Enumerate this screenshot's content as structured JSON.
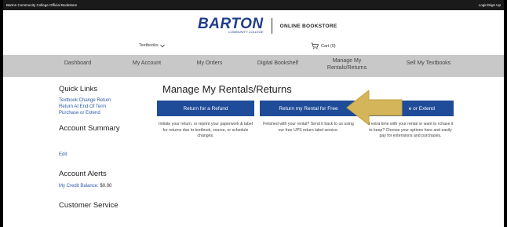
{
  "top_strip": {
    "site_label": "Barton Community College Official Bookstore",
    "login_label": "Login/Sign Up"
  },
  "brand": {
    "logo": "BARTON",
    "logo_sub": "COMMUNITY COLLEGE",
    "store_name": "ONLINE BOOKSTORE"
  },
  "subbar": {
    "textbooks_label": "Textbooks",
    "cart_label": "Cart (0)"
  },
  "nav": {
    "items": [
      {
        "label": "Dashboard"
      },
      {
        "label": "My Account"
      },
      {
        "label": "My Orders"
      },
      {
        "label": "Digital Bookshelf"
      },
      {
        "label": "Manage My\nRentals/Returns"
      },
      {
        "label": "Sell My Textbooks"
      }
    ]
  },
  "sidebar": {
    "quick_links_title": "Quick Links",
    "quick_links": [
      "Textbook Change Return",
      "Return At End Of Term",
      "Purchase or Extend"
    ],
    "account_summary_title": "Account Summary",
    "edit_label": "Edit",
    "account_alerts_title": "Account Alerts",
    "credit_balance_label": "My Credit Balance:",
    "credit_balance_value": "$0.00",
    "customer_service_title": "Customer Service"
  },
  "main": {
    "title": "Manage My Rentals/Returns",
    "actions": [
      {
        "label": "Return for a Refund",
        "description": "Initiate your return, or reprint your paperwork & label for returns due to textbook, course, or schedule changes."
      },
      {
        "label": "Return my Rental for Free",
        "description": "Finished with your rental? Send it back to us using our free UPS return label service."
      },
      {
        "label": "e or Extend",
        "description": "d extra time with your rental or want to rchase it to keep? Choose your options here and easily pay for extensions and purchases."
      }
    ]
  },
  "colors": {
    "brand_blue": "#1f3d8a",
    "button_blue": "#1f4c99",
    "nav_gray": "#c8c8c8",
    "link_blue": "#2d5aa6",
    "arrow_gold": "#d4b55a"
  },
  "icons": {
    "cart": "cart-icon",
    "chevron": "chevron-down-icon",
    "arrow": "arrow-left-icon"
  }
}
